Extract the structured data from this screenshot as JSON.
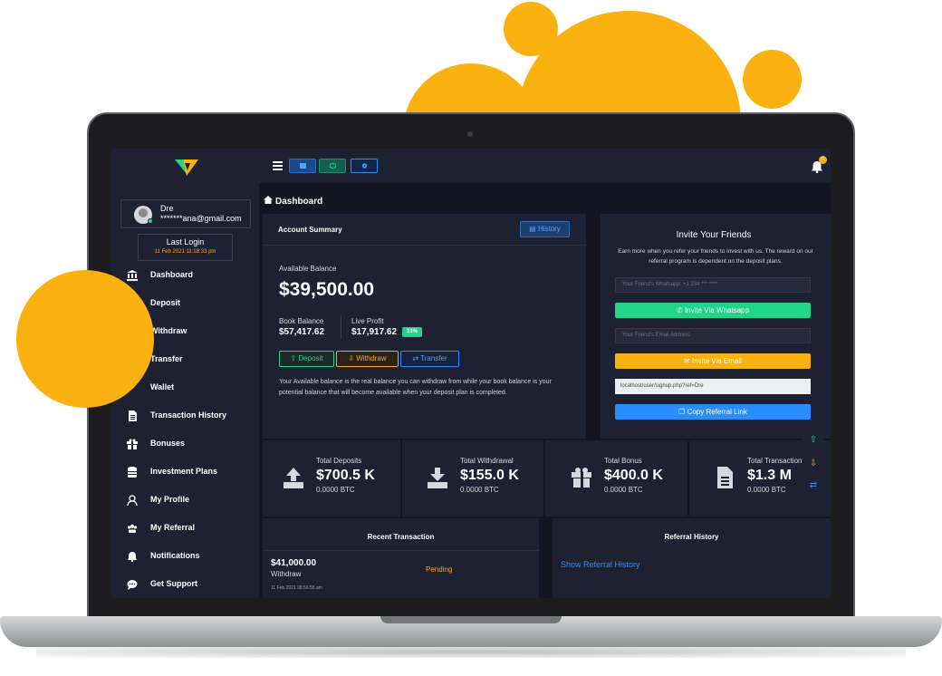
{
  "sidebar": {
    "user": {
      "name": "Dre",
      "email": "*******ana@gmail.com"
    },
    "last_login": {
      "title": "Last Login",
      "time": "11 Feb 2021 11:18:33 pm"
    },
    "items": [
      {
        "label": "Dashboard",
        "icon": "bank-icon"
      },
      {
        "label": "Deposit",
        "icon": "deposit-icon"
      },
      {
        "label": "Withdraw",
        "icon": "withdraw-icon"
      },
      {
        "label": "Transfer",
        "icon": "transfer-icon"
      },
      {
        "label": "Wallet",
        "icon": "wallet-icon"
      },
      {
        "label": "Transaction History",
        "icon": "document-icon"
      },
      {
        "label": "Bonuses",
        "icon": "gift-icon"
      },
      {
        "label": "Investment Plans",
        "icon": "database-icon"
      },
      {
        "label": "My Profile",
        "icon": "user-icon"
      },
      {
        "label": "My Referral",
        "icon": "users-icon"
      },
      {
        "label": "Notifications",
        "icon": "bell-icon"
      },
      {
        "label": "Get Support",
        "icon": "chat-icon"
      }
    ]
  },
  "topbar": {
    "notification_count": "0"
  },
  "page": {
    "title": "Dashboard"
  },
  "account": {
    "title": "Account Summary",
    "history_label": "History",
    "available_label": "Available Balance",
    "available_value": "$39,500.00",
    "book_label": "Book Balance",
    "book_value": "$57,417.62",
    "live_label": "Live Profit",
    "live_value": "$17,917.62",
    "live_pct": "31%",
    "deposit_label": "Deposit",
    "withdraw_label": "Withdraw",
    "transfer_label": "Transfer",
    "note": "Your Available balance is the real balance you can withdraw from while your book balance is your potential balance that will become available when your deposit plan is completed."
  },
  "invite": {
    "title": "Invite Your Friends",
    "description": "Earn more when you refer your friends to invest with us. The reward on our referral program is dependent on the deposit plans.",
    "whatsapp_placeholder": "Your Friend's Whatsapp: +1 234 *** ****",
    "whatsapp_button": "Invite Via Whatsapp",
    "email_placeholder": "Your Friend's Email Address",
    "email_button": "Invite Via Email",
    "referral_link": "localhost/user/signup.php?ref=Dre",
    "copy_button": "Copy Referral Link"
  },
  "stats": [
    {
      "label": "Total Deposits",
      "value": "$700.5 K",
      "sub": "0.0000 BTC",
      "icon": "upload-tray-icon"
    },
    {
      "label": "Total Withdrawal",
      "value": "$155.0 K",
      "sub": "0.0000 BTC",
      "icon": "download-tray-icon"
    },
    {
      "label": "Total Bonus",
      "value": "$400.0 K",
      "sub": "0.0000 BTC",
      "icon": "gift-icon"
    },
    {
      "label": "Total Transactions",
      "value": "$1.3 M",
      "sub": "0.0000 BTC",
      "icon": "file-icon"
    }
  ],
  "recent": {
    "title": "Recent Transaction",
    "amount": "$41,000.00",
    "type": "Withdraw",
    "status": "Pending",
    "date": "11 Feb 2021 08:56:55 am"
  },
  "referral_history": {
    "title": "Referral History",
    "link_label": "Show Referral History"
  },
  "colors": {
    "accent": "#fbb10f",
    "success": "#20d489",
    "info": "#2b8cff",
    "panel": "#1e2131",
    "background": "#141521"
  }
}
